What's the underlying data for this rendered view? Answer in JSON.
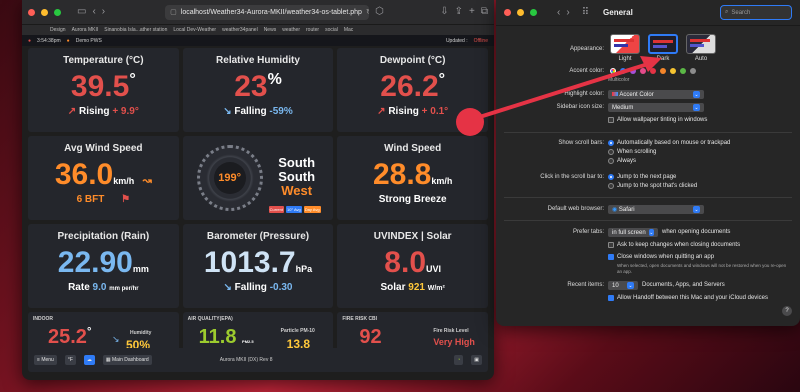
{
  "safari": {
    "url": "localhost/Weather34-Aurora-MKII/weather34-os-tablet.php",
    "bookmarks": [
      "Design",
      "Aurora MKII",
      "Sinanobia Isla...ather station",
      "Local Dev-Weather",
      "weather34panel",
      "News",
      "weather",
      "router",
      "social",
      "Mac"
    ]
  },
  "weather": {
    "time": "3:54:38pm",
    "station": "Demo PWS",
    "updated_label": "Updated :",
    "updated_status": "Offline",
    "temperature": {
      "title": "Temperature (°C)",
      "value": "39.5",
      "unit": "°",
      "trend": "Rising",
      "delta": "+ 9.9°"
    },
    "humidity": {
      "title": "Relative Humidity",
      "value": "23",
      "unit": "%",
      "trend": "Falling",
      "delta": "-59%"
    },
    "dewpoint": {
      "title": "Dewpoint (°C)",
      "value": "26.2",
      "unit": "°",
      "trend": "Rising",
      "delta": "+ 0.1°"
    },
    "wind": {
      "title": "Avg Wind Speed",
      "value": "36.0",
      "unit": "km/h",
      "bft": "6 BFT"
    },
    "direction": {
      "degrees": "199°",
      "line1": "South",
      "line2": "South",
      "line3": "West",
      "tags": [
        "Current",
        "10° Avg",
        "Day Avg"
      ]
    },
    "windspeed": {
      "title": "Wind Speed",
      "value": "28.8",
      "unit": "km/h",
      "description": "Strong Breeze"
    },
    "rain": {
      "title": "Precipitation (Rain)",
      "value": "22.90",
      "unit": "mm",
      "rate_label": "Rate",
      "rate_value": "9.0",
      "rate_unit": "mm per/hr"
    },
    "barometer": {
      "title": "Barometer (Pressure)",
      "value": "1013.7",
      "unit": "hPa",
      "trend": "Falling",
      "delta": "-0.30"
    },
    "uv": {
      "title": "UVINDEX | Solar",
      "value": "8.0",
      "unit": "UVI",
      "solar_label": "Solar",
      "solar_value": "921",
      "solar_unit": "W/m²"
    },
    "indoor": {
      "label": "INDOOR",
      "value": "25.2",
      "unit": "°",
      "humidity_label": "Humidity",
      "humidity_value": "50%"
    },
    "air": {
      "label": "AIR QUALITY(EPA)",
      "value": "11.8",
      "unit": "PM2.5",
      "pm10_label": "Particle PM-10",
      "pm10_value": "13.8"
    },
    "fire": {
      "label": "FIRE RISK CBI",
      "value": "92",
      "level_label": "Fire Risk Level",
      "level_value": "Very High"
    },
    "footer": {
      "menu": "Menu",
      "units": "°F",
      "dashboard": "Main Dashboard",
      "version": "Aurora MKII (DX) Rev 8"
    }
  },
  "settings": {
    "title": "General",
    "search_placeholder": "Search",
    "appearance_label": "Appearance:",
    "appearance_options": [
      "Light",
      "Dark",
      "Auto"
    ],
    "accent_label": "Accent color:",
    "accent_name": "Multicolor",
    "highlight_label": "Highlight color:",
    "highlight_value": "Accent Color",
    "sidebar_label": "Sidebar icon size:",
    "sidebar_value": "Medium",
    "wallpaper_tint": "Allow wallpaper tinting in windows",
    "scrollbars_label": "Show scroll bars:",
    "scrollbars_options": [
      "Automatically based on mouse or trackpad",
      "When scrolling",
      "Always"
    ],
    "click_label": "Click in the scroll bar to:",
    "click_options": [
      "Jump to the next page",
      "Jump to the spot that's clicked"
    ],
    "browser_label": "Default web browser:",
    "browser_value": "Safari",
    "tabs_label": "Prefer tabs:",
    "tabs_value": "in full screen",
    "tabs_suffix": "when opening documents",
    "ask_keep": "Ask to keep changes when closing documents",
    "close_windows": "Close windows when quitting an app",
    "close_note": "When selected, open documents and windows will not be restored when you re-open an app.",
    "recent_label": "Recent items:",
    "recent_value": "10",
    "recent_suffix": "Documents, Apps, and Servers",
    "handoff": "Allow Handoff between this Mac and your iCloud devices",
    "help": "?"
  },
  "colors": {
    "accent_blue": "#2f7bf6",
    "arrow_red": "#e53345",
    "temp_red": "#e2504c",
    "wx_orange": "#ff8c2a",
    "wx_blue": "#7ab8f0"
  }
}
